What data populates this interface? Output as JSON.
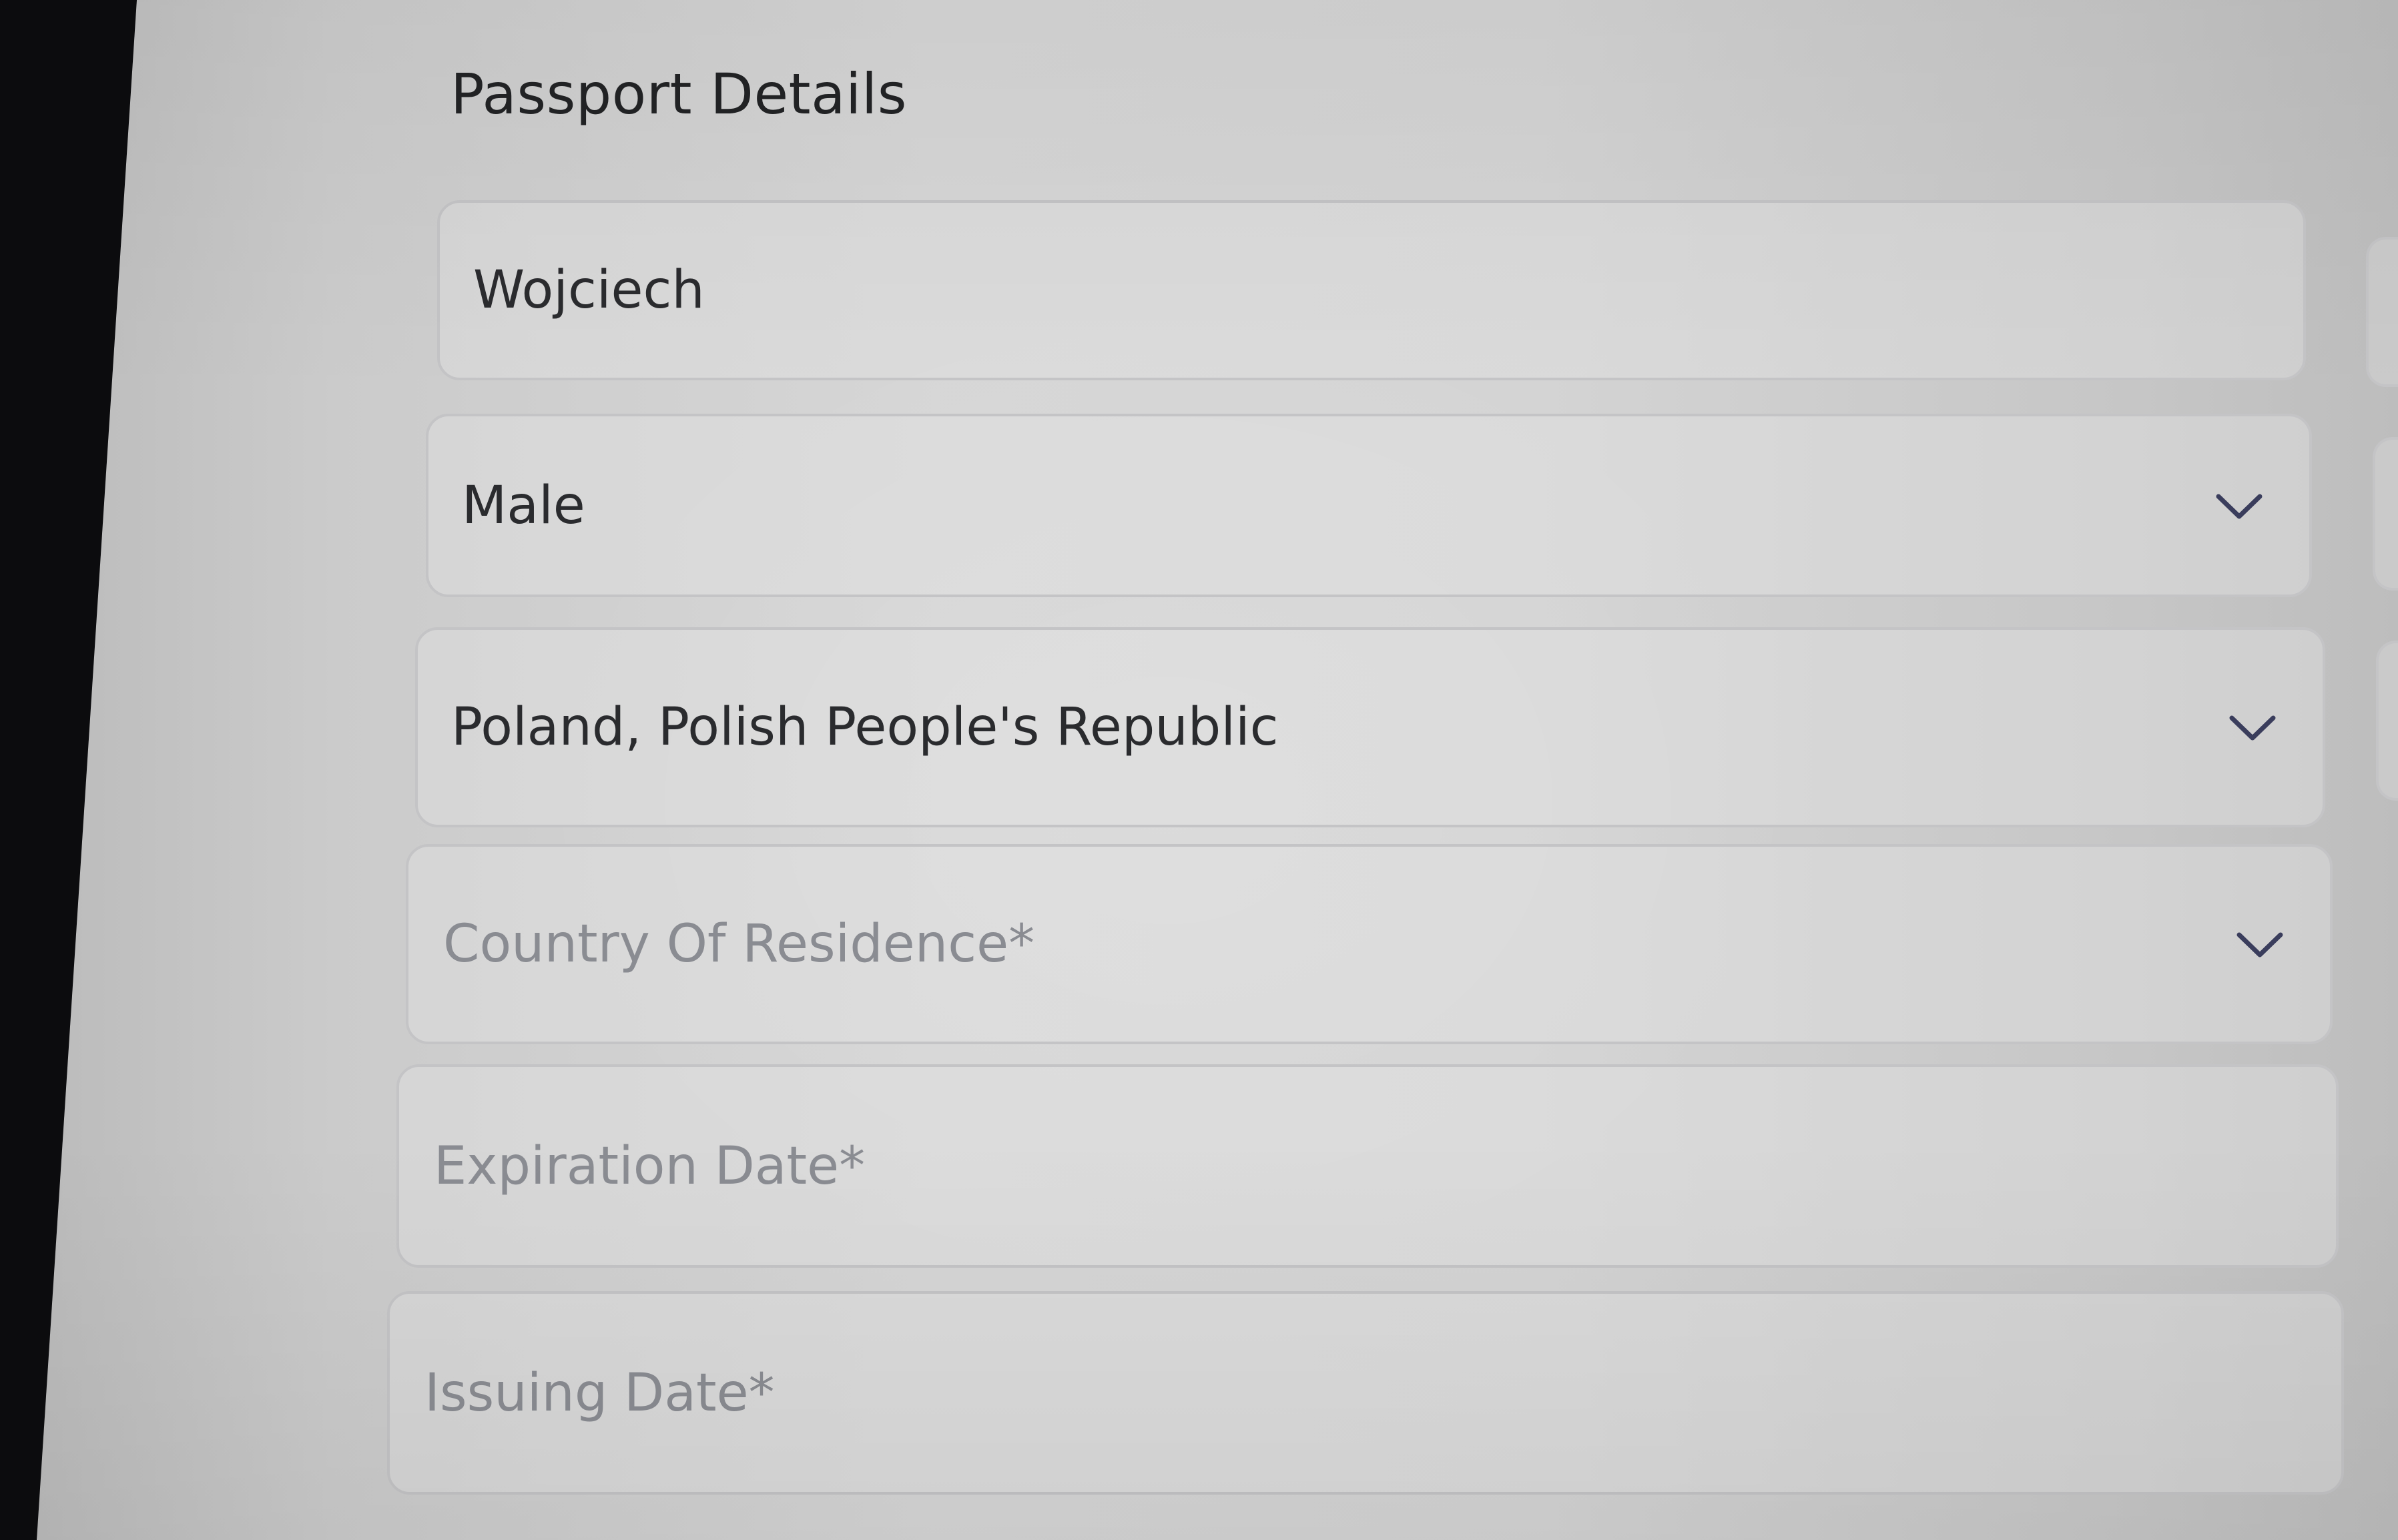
{
  "form": {
    "title": "Passport Details",
    "first_name": {
      "value": "Wojciech"
    },
    "gender": {
      "value": "Male"
    },
    "nationality": {
      "value": "Poland, Polish People's Republic"
    },
    "country_of_residence": {
      "placeholder": "Country Of Residence*"
    },
    "expiration_date": {
      "placeholder": "Expiration Date*"
    },
    "issuing_date": {
      "placeholder": "Issuing Date*"
    }
  },
  "icons": {
    "dropdown": "chevron-down-icon"
  },
  "colors": {
    "text": "#2a2b2e",
    "placeholder": "#8a8c92",
    "border": "#c4c4c6",
    "chevron": "#3a3d5c"
  }
}
